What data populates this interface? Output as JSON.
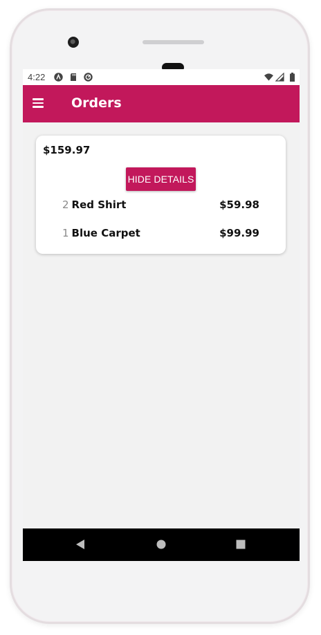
{
  "status_bar": {
    "time": "4:22"
  },
  "app_bar": {
    "title": "Orders",
    "menu_icon": "hamburger-menu-icon"
  },
  "order": {
    "total": "$159.97",
    "toggle_label": "HIDE DETAILS",
    "items": [
      {
        "quantity": "2",
        "name": "Red Shirt",
        "price": "$59.98"
      },
      {
        "quantity": "1",
        "name": "Blue Carpet",
        "price": "$99.99"
      }
    ]
  },
  "nav_bar": {
    "back_icon": "back-triangle-icon",
    "home_icon": "home-circle-icon",
    "recents_icon": "recents-square-icon"
  },
  "colors": {
    "accent": "#c2185b",
    "background": "#f2f2f2",
    "card": "#ffffff",
    "nav_bar": "#000000"
  }
}
